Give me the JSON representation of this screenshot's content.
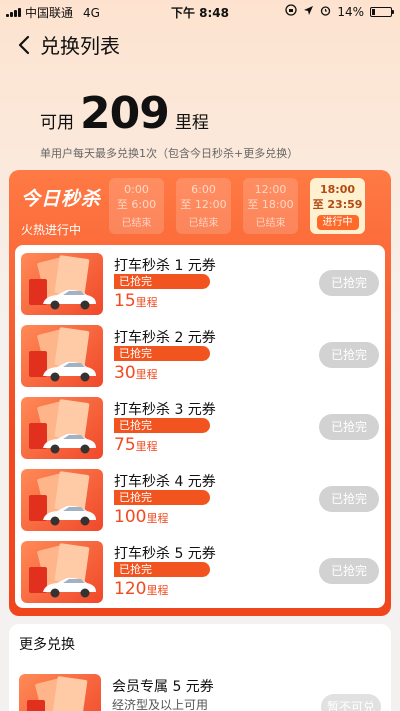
{
  "status_bar": {
    "carrier": "中国联通",
    "network": "4G",
    "time": "下午 8:48",
    "battery": "14%",
    "battery_level": 0.14
  },
  "nav": {
    "title": "兑换列表"
  },
  "points": {
    "label": "可用",
    "value": "209",
    "unit": "里程",
    "note": "单用户每天最多兑换1次（包含今日秒杀+更多兑换）"
  },
  "flash": {
    "brand": "今日秒杀",
    "status": "火热进行中",
    "slots": [
      {
        "start": "0:00",
        "end": "至 6:00",
        "state": "已结束"
      },
      {
        "start": "6:00",
        "end": "至 12:00",
        "state": "已结束"
      },
      {
        "start": "12:00",
        "end": "至 18:00",
        "state": "已结束"
      },
      {
        "start": "18:00",
        "end": "至 23:59",
        "state": "进行中"
      }
    ],
    "coupons": [
      {
        "title": "打车秒杀 1 元券",
        "tag": "已抢完",
        "price": "15",
        "unit": "里程",
        "button": "已抢完"
      },
      {
        "title": "打车秒杀 2 元券",
        "tag": "已抢完",
        "price": "30",
        "unit": "里程",
        "button": "已抢完"
      },
      {
        "title": "打车秒杀 3 元券",
        "tag": "已抢完",
        "price": "75",
        "unit": "里程",
        "button": "已抢完"
      },
      {
        "title": "打车秒杀 4 元券",
        "tag": "已抢完",
        "price": "100",
        "unit": "里程",
        "button": "已抢完"
      },
      {
        "title": "打车秒杀 5 元券",
        "tag": "已抢完",
        "price": "120",
        "unit": "里程",
        "button": "已抢完"
      }
    ]
  },
  "more": {
    "title": "更多兑换",
    "item": {
      "title": "会员专属 5 元券",
      "subtitle": "经济型及以上可用",
      "button": "暂不可兑"
    }
  }
}
